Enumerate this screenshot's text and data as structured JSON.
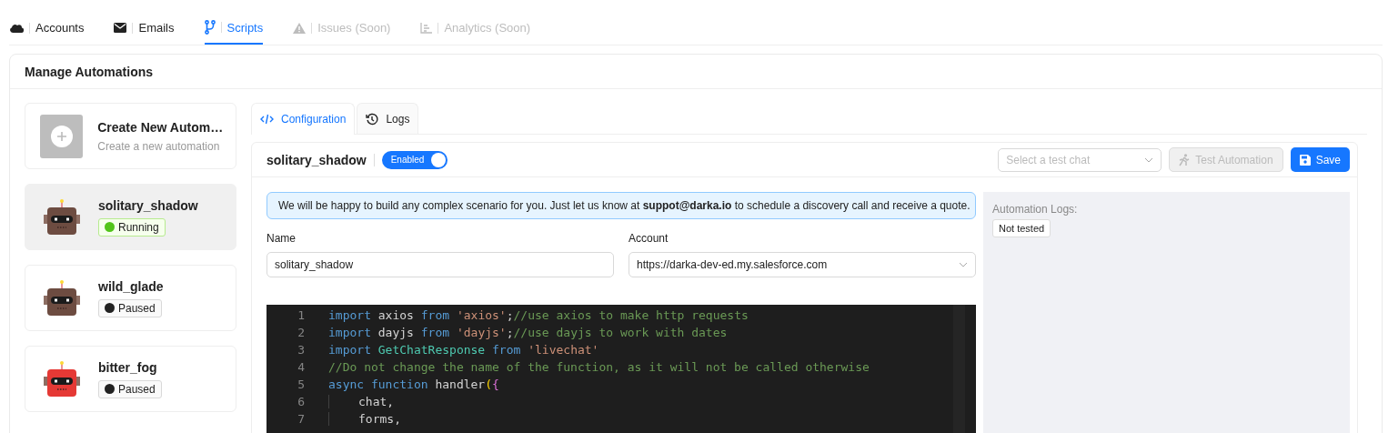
{
  "nav_tabs": [
    {
      "label": "Accounts",
      "selected": false,
      "disabled": false
    },
    {
      "label": "Emails",
      "selected": false,
      "disabled": false
    },
    {
      "label": "Scripts",
      "selected": true,
      "disabled": false
    },
    {
      "label": "Issues (Soon)",
      "selected": false,
      "disabled": true
    },
    {
      "label": "Analytics (Soon)",
      "selected": false,
      "disabled": true
    }
  ],
  "panel": {
    "title": "Manage Automations"
  },
  "create_card": {
    "title": "Create New Autom…",
    "subtitle": "Create a new automation"
  },
  "automations": [
    {
      "name": "solitary_shadow",
      "status": "Running",
      "kind": "running",
      "selected": true,
      "color": "#6d4c41"
    },
    {
      "name": "wild_glade",
      "status": "Paused",
      "kind": "paused",
      "selected": false,
      "color": "#6d4c41"
    },
    {
      "name": "bitter_fog",
      "status": "Paused",
      "kind": "paused",
      "selected": false,
      "color": "#e53935"
    }
  ],
  "editor_tabs": [
    {
      "label": "Configuration",
      "selected": true
    },
    {
      "label": "Logs",
      "selected": false
    }
  ],
  "header": {
    "name": "solitary_shadow",
    "toggle_label": "Enabled",
    "enabled": true,
    "test_chat_placeholder": "Select a test chat",
    "test_button": "Test Automation",
    "test_disabled": true,
    "save_button": "Save"
  },
  "notice": "We will be happy to build any complex scenario for you. Just let us know at **suppot@darka.io** to schedule a discovery call and receive a quote.",
  "form": {
    "name_label": "Name",
    "name_value": "solitary_shadow",
    "account_label": "Account",
    "account_value": "https://darka-dev-ed.my.salesforce.com"
  },
  "code_lines": [
    {
      "number": "1",
      "indent": false,
      "tokens": [
        {
          "kind": "keyword",
          "text": "import"
        },
        {
          "kind": "plain",
          "text": " axios "
        },
        {
          "kind": "keyword",
          "text": "from "
        },
        {
          "kind": "string",
          "text": "'axios'"
        },
        {
          "kind": "plain",
          "text": ";"
        },
        {
          "kind": "comment",
          "text": "//use axios to make http requests"
        }
      ]
    },
    {
      "number": "2",
      "indent": false,
      "tokens": [
        {
          "kind": "keyword",
          "text": "import"
        },
        {
          "kind": "plain",
          "text": " dayjs "
        },
        {
          "kind": "keyword",
          "text": "from "
        },
        {
          "kind": "string",
          "text": "'dayjs'"
        },
        {
          "kind": "plain",
          "text": ";"
        },
        {
          "kind": "comment",
          "text": "//use dayjs to work with dates"
        }
      ]
    },
    {
      "number": "3",
      "indent": false,
      "tokens": [
        {
          "kind": "keyword",
          "text": "import "
        },
        {
          "kind": "type",
          "text": "GetChatResponse "
        },
        {
          "kind": "keyword",
          "text": "from "
        },
        {
          "kind": "string",
          "text": "'livechat'"
        }
      ]
    },
    {
      "number": "4",
      "indent": false,
      "tokens": [
        {
          "kind": "comment",
          "text": "//Do not change the name of the function, as it will not be called otherwise"
        }
      ]
    },
    {
      "number": "5",
      "indent": false,
      "tokens": [
        {
          "kind": "keyword",
          "text": "async function"
        },
        {
          "kind": "plain",
          "text": " handler"
        },
        {
          "kind": "bracket",
          "text": "("
        },
        {
          "kind": "brace",
          "text": "{"
        }
      ]
    },
    {
      "number": "6",
      "indent": true,
      "tokens": [
        {
          "kind": "plain",
          "text": "chat,"
        }
      ]
    },
    {
      "number": "7",
      "indent": true,
      "tokens": [
        {
          "kind": "plain",
          "text": "forms,"
        }
      ]
    }
  ],
  "logs": {
    "label": "Automation Logs:",
    "badge": "Not tested"
  }
}
